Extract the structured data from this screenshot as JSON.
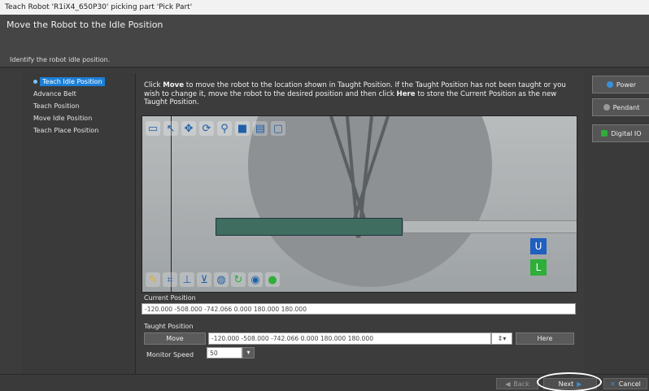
{
  "window": {
    "title": "Teach Robot 'R1iX4_650P30' picking part 'Pick Part'"
  },
  "header": {
    "title": "Move the Robot to the Idle Position",
    "subtitle": "Identify the robot idle position."
  },
  "nav": {
    "items": [
      {
        "label": "Teach Idle Position",
        "active": true
      },
      {
        "label": "Advance Belt"
      },
      {
        "label": "Teach Position"
      },
      {
        "label": "Move Idle Position"
      },
      {
        "label": "Teach Place Position"
      }
    ]
  },
  "instructions": {
    "part1": "Click ",
    "move": "Move",
    "part2": " to move the robot to the location shown in Taught Position. If the Taught Position has not been taught or you wish to change it, move the robot to the desired position and then click ",
    "here": "Here",
    "part3": " to store the Current Position as the new Taught Position."
  },
  "viewport": {
    "u_label": "U",
    "l_label": "L",
    "colors": {
      "u": "#1f5fbf",
      "l": "#2fae3a",
      "belt": "#3f6d5f"
    }
  },
  "current_position": {
    "label": "Current Position",
    "value": "-120.000 -508.000 -742.066 0.000 180.000 180.000"
  },
  "taught_position": {
    "label": "Taught Position",
    "move_button": "Move",
    "value": "-120.000 -508.000 -742.066 0.000 180.000 180.000",
    "here_button": "Here"
  },
  "monitor_speed": {
    "label": "Monitor Speed",
    "value": "50"
  },
  "side_buttons": [
    {
      "label": "Power",
      "icon": "power-icon"
    },
    {
      "label": "Pendant",
      "icon": "pendant-icon"
    },
    {
      "label": "Digital IO",
      "icon": "digital-io-icon"
    }
  ],
  "footer": {
    "back": "Back",
    "next": "Next",
    "cancel": "Cancel"
  }
}
